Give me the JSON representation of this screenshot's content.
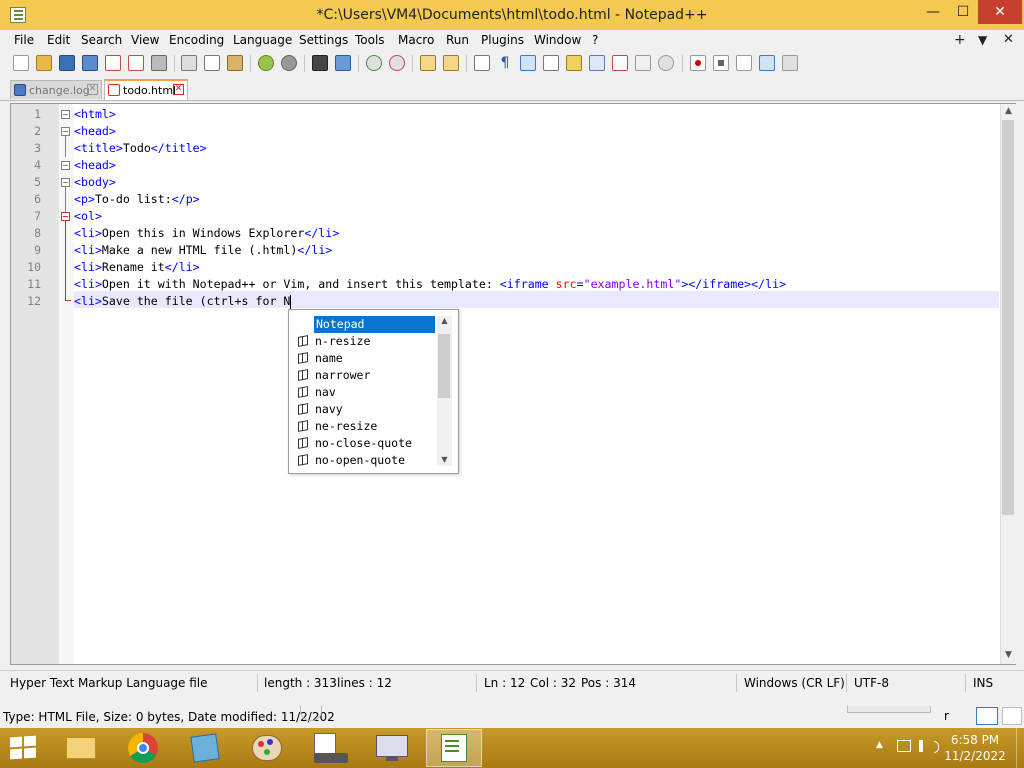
{
  "window": {
    "title": "*C:\\Users\\VM4\\Documents\\html\\todo.html - Notepad++",
    "min_label": "—",
    "max_label": "☐",
    "close_label": "✕"
  },
  "menu": {
    "items": [
      "File",
      "Edit",
      "Search",
      "View",
      "Encoding",
      "Language",
      "Settings",
      "Tools",
      "Macro",
      "Run",
      "Plugins",
      "Window",
      "?"
    ],
    "plus_label": "+",
    "dropdown_label": "▼",
    "close_label": "✕"
  },
  "tabs": [
    {
      "label": "change.log",
      "icon": "saved-file-icon",
      "active": false
    },
    {
      "label": "todo.html",
      "icon": "unsaved-file-icon",
      "active": true
    }
  ],
  "editor": {
    "line_numbers": [
      "1",
      "2",
      "3",
      "4",
      "5",
      "6",
      "7",
      "8",
      "9",
      "10",
      "11",
      "12"
    ],
    "current_line": 12
  },
  "autocomplete": {
    "items": [
      "Notepad",
      "n-resize",
      "name",
      "narrower",
      "nav",
      "navy",
      "ne-resize",
      "no-close-quote",
      "no-open-quote"
    ],
    "selected_index": 0
  },
  "status": {
    "file_type": "Hyper Text Markup Language file",
    "length": "length : 313",
    "lines": "lines : 12",
    "ln": "Ln : 12",
    "col": "Col : 32",
    "pos": "Pos : 314",
    "eol": "Windows (CR LF)",
    "encoding": "UTF-8",
    "mode": "INS"
  },
  "explorer_status": "Type: HTML File, Size: 0 bytes, Date modified: 11/2/202",
  "taskbar": {
    "apps": [
      "file-explorer-icon",
      "chrome-icon",
      "notebook-icon",
      "paint-icon",
      "task-manager-icon",
      "remote-desktop-icon",
      "notepad-plus-plus-icon"
    ],
    "active_app": "notepad-plus-plus-icon",
    "time": "6:58 PM",
    "date": "11/2/2022"
  },
  "colors": {
    "titlebar": "#f3c94f",
    "tag": "#0000ff",
    "attribute": "#ff0000",
    "attr_value": "#8000ff",
    "selection": "#0a74d0",
    "close_button": "#c7402f"
  }
}
